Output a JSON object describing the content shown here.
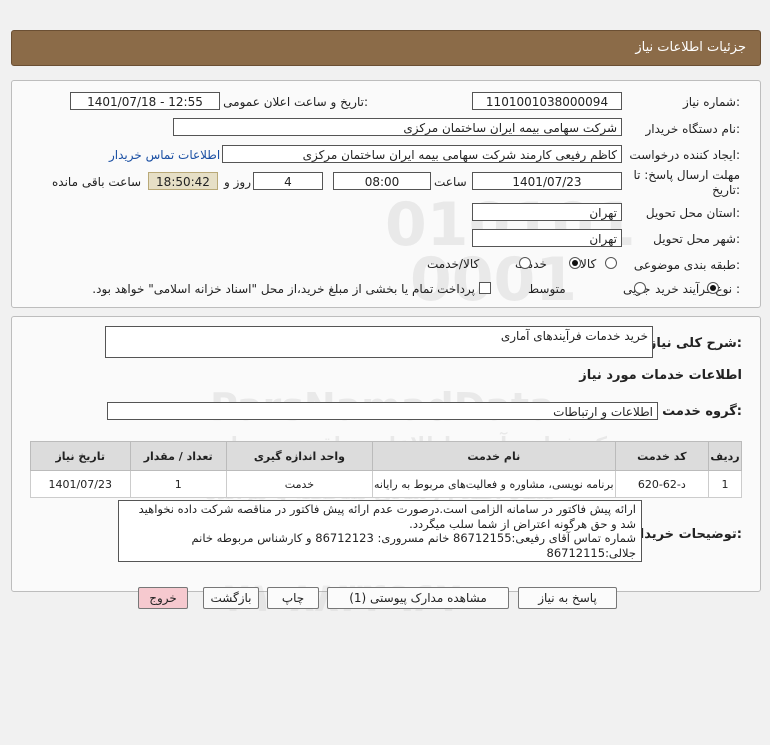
{
  "header": {
    "title": "جزئیات اطلاعات نیاز"
  },
  "fields": {
    "need_number_label": "شماره نیاز:",
    "need_number": "1101001038000094",
    "announce_label": "تاریخ و ساعت اعلان عمومی:",
    "announce_value": "1401/07/18 - 12:55",
    "buyer_org_label": "نام دستگاه خریدار:",
    "buyer_org": "شرکت سهامی بیمه ایران ساختمان مرکزی",
    "requester_label": "ایجاد کننده درخواست:",
    "requester": "کاظم رفیعی کارمند شرکت سهامی بیمه ایران ساختمان مرکزی",
    "contact_link": "اطلاعات تماس خریدار",
    "deadline_label_1": "مهلت ارسال پاسخ: تا",
    "deadline_label_2": "تاریخ:",
    "deadline_date": "1401/07/23",
    "time_label": "ساعت",
    "deadline_time": "08:00",
    "days_value": "4",
    "days_label": "روز و",
    "remaining_time": "18:50:42",
    "remaining_label": "ساعت باقی مانده",
    "delivery_province_label": "استان محل تحویل:",
    "delivery_province": "تهران",
    "delivery_city_label": "شهر محل تحویل:",
    "delivery_city": "تهران",
    "category_label": "طبقه بندی موضوعی:",
    "category_options": [
      "کالا",
      "خدمت",
      "کالا/خدمت"
    ],
    "category_selected": "خدمت",
    "process_label": "نوع فرآیند خرید :",
    "process_options": [
      "جزیی",
      "متوسط"
    ],
    "process_selected": "جزیی",
    "payment_note": "پرداخت تمام یا بخشی از مبلغ خرید،از محل \"اسناد خزانه اسلامی\" خواهد بود."
  },
  "summary": {
    "label": "شرح کلی نیاز:",
    "value": "خرید خدمات فرآیندهای آماری"
  },
  "services": {
    "section_title": "اطلاعات خدمات مورد نیاز",
    "group_label": "گروه خدمت:",
    "group_value": "اطلاعات و ارتباطات",
    "columns": [
      "ردیف",
      "کد خدمت",
      "نام خدمت",
      "واحد اندازه گیری",
      "تعداد / مقدار",
      "تاریخ نیاز"
    ],
    "rows": [
      {
        "row": "1",
        "code": "د-62-620",
        "name": "برنامه نویسی، مشاوره و فعالیت‌های مربوط به رایانه",
        "unit": "خدمت",
        "qty": "1",
        "date": "1401/07/23"
      }
    ]
  },
  "buyer_notes": {
    "label": "توضیحات خریدار:",
    "lines": [
      "ارائه پیش فاکتور در سامانه الزامی است.درصورت عدم ارائه پیش فاکتور در مناقصه شرکت داده نخواهید",
      "شد و حق هرگونه اعتراض از شما سلب میگردد.",
      "شماره تماس آقای رفیعی:86712155  خانم مسروری: 86712123 و کارشناس مربوطه خانم",
      "جلالی:86712115"
    ]
  },
  "buttons": {
    "reply": "پاسخ به نیاز",
    "attachments": "مشاهده مدارک پیوستی (1)",
    "print": "چاپ",
    "back": "بازگشت",
    "exit": "خروج"
  },
  "watermark": {
    "digits_1": "010101",
    "digits_2": "0001",
    "brand": "ParsNamadData",
    "slogan": "مرکز فراهم آوری اطلاعات مناقصه و مزایده",
    "slogan_2": "پیگاه اطلاع رسانی مناقصه و مزایده",
    "phone": "۰۲۱-۸۸۳۴۹۶۷۰"
  },
  "colors": {
    "title_bar": "#8b6b48",
    "link": "#1a4fa3",
    "remaining_bg": "#e6dfc6",
    "exit_button": "#f6c9cf"
  }
}
